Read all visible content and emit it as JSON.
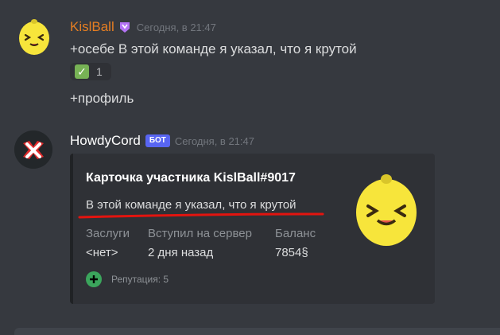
{
  "messages": [
    {
      "author": "KislBall",
      "timestamp": "Сегодня, в 21:47",
      "lines": [
        "+осебе В этой команде я указал, что я крутой",
        "+профиль"
      ],
      "reaction": {
        "emoji": "✅",
        "count": "1"
      },
      "author_color": "#e67e22",
      "avatar_icon": "lemon-face-icon",
      "badge_icon": "nitro-badge-icon"
    },
    {
      "author": "HowdyCord",
      "bot_tag": "БОТ",
      "timestamp": "Сегодня, в 21:47",
      "avatar_icon": "howdycord-x-icon",
      "embed": {
        "title": "Карточка участника KislBall#9017",
        "description": "В этой команде я указал, что я крутой",
        "fields": [
          {
            "name": "Заслуги",
            "value": "<нет>"
          },
          {
            "name": "Вступил на сервер",
            "value": "2 дня назад"
          },
          {
            "name": "Баланс",
            "value": "7854§"
          }
        ],
        "footer": "Репутация: 5",
        "footer_icon": "green-plus-icon",
        "thumbnail_icon": "lemon-face-icon",
        "annotation_color": "#e3140f"
      }
    }
  ],
  "colors": {
    "background": "#36393f",
    "embed_background": "#2f3136",
    "bot_tag": "#5865f2",
    "timestamp": "#72767d"
  }
}
